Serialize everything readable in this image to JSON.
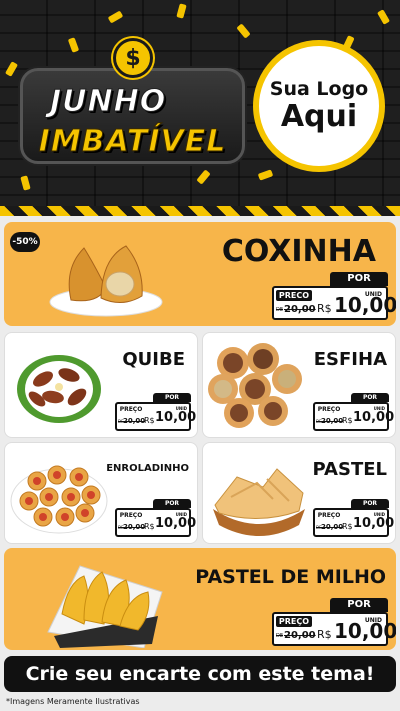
{
  "header": {
    "brand_line1": "JUNHO",
    "brand_line2": "IMBATÍVEL",
    "coin_symbol": "$",
    "logo_line1": "Sua Logo",
    "logo_line2": "Aqui"
  },
  "colors": {
    "accent": "#f5c400",
    "card_orange": "#f7b54a",
    "dark": "#111111"
  },
  "products": {
    "coxinha": {
      "name": "COXINHA",
      "discount": "-50%",
      "por": "POR",
      "preco": "PRECO",
      "de": "DE",
      "old": "20,00",
      "currency": "R$",
      "price": "10,00",
      "unit": "UNID",
      "icon": "coxinha-image"
    },
    "quibe": {
      "name": "QUIBE",
      "por": "POR",
      "preco": "PREÇO",
      "de": "DE",
      "old": "20,00",
      "currency": "R$",
      "price": "10,00",
      "unit": "UNID",
      "icon": "quibe-image"
    },
    "esfiha": {
      "name": "ESFIHA",
      "por": "POR",
      "preco": "PREÇO",
      "de": "DE",
      "old": "20,00",
      "currency": "R$",
      "price": "10,00",
      "unit": "UNID",
      "icon": "esfiha-image"
    },
    "enroladinho": {
      "name": "ENROLADINHO",
      "por": "POR",
      "preco": "PREÇO",
      "de": "DE",
      "old": "20,00",
      "currency": "R$",
      "price": "10,00",
      "unit": "UNID",
      "icon": "enroladinho-image"
    },
    "pastel": {
      "name": "PASTEL",
      "por": "POR",
      "preco": "PREÇO",
      "de": "DE",
      "old": "20,00",
      "currency": "R$",
      "price": "10,00",
      "unit": "UNID",
      "icon": "pastel-image"
    },
    "pastel_milho": {
      "name": "PASTEL DE MILHO",
      "por": "POR",
      "preco": "PREÇO",
      "de": "DE",
      "old": "20,00",
      "currency": "R$",
      "price": "10,00",
      "unit": "UNID",
      "icon": "pastel-milho-image"
    }
  },
  "footer": {
    "cta": "Crie seu encarte com este tema!",
    "note": "*Imagens Meramente Ilustrativas"
  }
}
